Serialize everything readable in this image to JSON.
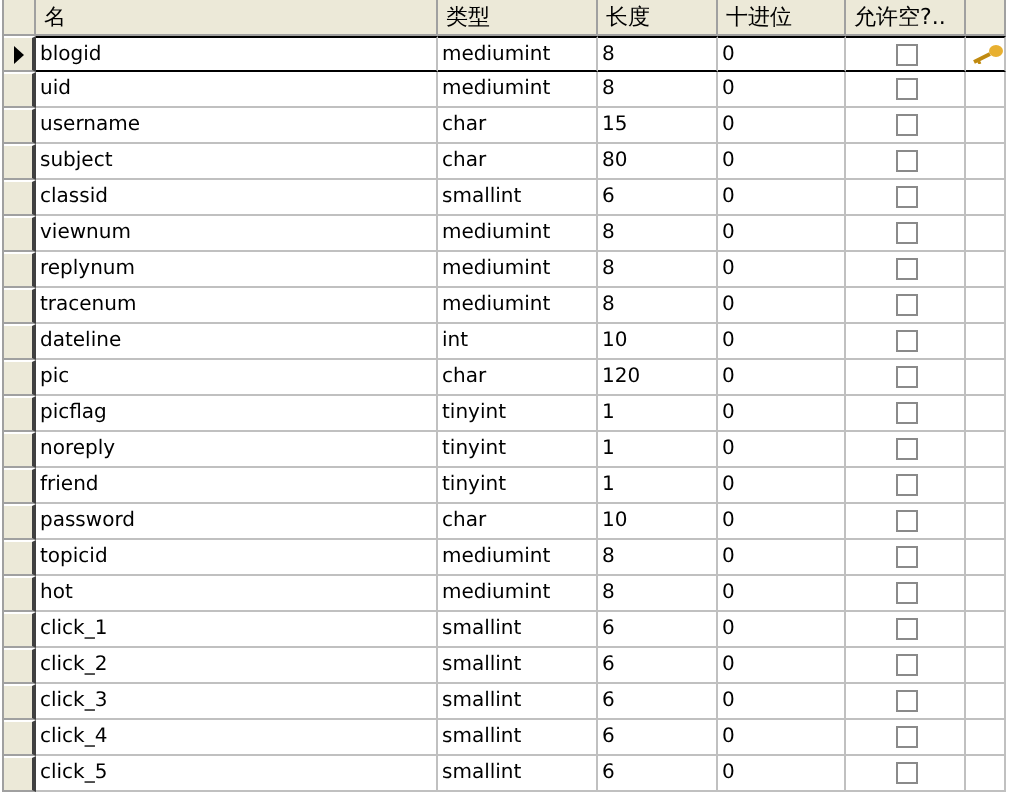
{
  "columns": [
    "名",
    "类型",
    "长度",
    "十进位",
    "允许空?.."
  ],
  "rows": [
    {
      "name": "blogid",
      "type": "mediumint",
      "length": "8",
      "decimals": "0",
      "allow_null": false,
      "primary_key": true,
      "current": true
    },
    {
      "name": "uid",
      "type": "mediumint",
      "length": "8",
      "decimals": "0",
      "allow_null": false,
      "primary_key": false,
      "current": false
    },
    {
      "name": "username",
      "type": "char",
      "length": "15",
      "decimals": "0",
      "allow_null": false,
      "primary_key": false,
      "current": false
    },
    {
      "name": "subject",
      "type": "char",
      "length": "80",
      "decimals": "0",
      "allow_null": false,
      "primary_key": false,
      "current": false
    },
    {
      "name": "classid",
      "type": "smallint",
      "length": "6",
      "decimals": "0",
      "allow_null": false,
      "primary_key": false,
      "current": false
    },
    {
      "name": "viewnum",
      "type": "mediumint",
      "length": "8",
      "decimals": "0",
      "allow_null": false,
      "primary_key": false,
      "current": false
    },
    {
      "name": "replynum",
      "type": "mediumint",
      "length": "8",
      "decimals": "0",
      "allow_null": false,
      "primary_key": false,
      "current": false
    },
    {
      "name": "tracenum",
      "type": "mediumint",
      "length": "8",
      "decimals": "0",
      "allow_null": false,
      "primary_key": false,
      "current": false
    },
    {
      "name": "dateline",
      "type": "int",
      "length": "10",
      "decimals": "0",
      "allow_null": false,
      "primary_key": false,
      "current": false
    },
    {
      "name": "pic",
      "type": "char",
      "length": "120",
      "decimals": "0",
      "allow_null": false,
      "primary_key": false,
      "current": false
    },
    {
      "name": "picflag",
      "type": "tinyint",
      "length": "1",
      "decimals": "0",
      "allow_null": false,
      "primary_key": false,
      "current": false
    },
    {
      "name": "noreply",
      "type": "tinyint",
      "length": "1",
      "decimals": "0",
      "allow_null": false,
      "primary_key": false,
      "current": false
    },
    {
      "name": "friend",
      "type": "tinyint",
      "length": "1",
      "decimals": "0",
      "allow_null": false,
      "primary_key": false,
      "current": false
    },
    {
      "name": "password",
      "type": "char",
      "length": "10",
      "decimals": "0",
      "allow_null": false,
      "primary_key": false,
      "current": false
    },
    {
      "name": "topicid",
      "type": "mediumint",
      "length": "8",
      "decimals": "0",
      "allow_null": false,
      "primary_key": false,
      "current": false
    },
    {
      "name": "hot",
      "type": "mediumint",
      "length": "8",
      "decimals": "0",
      "allow_null": false,
      "primary_key": false,
      "current": false
    },
    {
      "name": "click_1",
      "type": "smallint",
      "length": "6",
      "decimals": "0",
      "allow_null": false,
      "primary_key": false,
      "current": false
    },
    {
      "name": "click_2",
      "type": "smallint",
      "length": "6",
      "decimals": "0",
      "allow_null": false,
      "primary_key": false,
      "current": false
    },
    {
      "name": "click_3",
      "type": "smallint",
      "length": "6",
      "decimals": "0",
      "allow_null": false,
      "primary_key": false,
      "current": false
    },
    {
      "name": "click_4",
      "type": "smallint",
      "length": "6",
      "decimals": "0",
      "allow_null": false,
      "primary_key": false,
      "current": false
    },
    {
      "name": "click_5",
      "type": "smallint",
      "length": "6",
      "decimals": "0",
      "allow_null": false,
      "primary_key": false,
      "current": false
    }
  ]
}
